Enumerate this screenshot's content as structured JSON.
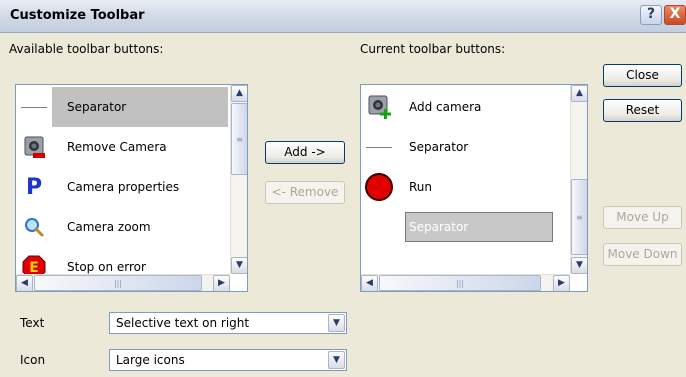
{
  "window": {
    "title": "Customize Toolbar",
    "help_label": "?",
    "close_label": "X"
  },
  "available": {
    "label": "Available toolbar buttons:",
    "items": [
      {
        "label": "Separator",
        "icon": "separator-line",
        "selected": true
      },
      {
        "label": "Remove Camera",
        "icon": "remove-camera-icon"
      },
      {
        "label": "Camera properties",
        "icon": "properties-p-icon"
      },
      {
        "label": "Camera zoom",
        "icon": "zoom-magnifier-icon"
      },
      {
        "label": "Stop on error",
        "icon": "stop-on-error-icon"
      }
    ]
  },
  "current": {
    "label": "Current toolbar buttons:",
    "items": [
      {
        "label": "Add camera",
        "icon": "add-camera-icon"
      },
      {
        "label": "Separator",
        "icon": "separator-line"
      },
      {
        "label": "Run",
        "icon": "run-red-circle-icon"
      },
      {
        "label": "Separator",
        "icon": "separator-placeholder",
        "dragging": true
      }
    ]
  },
  "buttons": {
    "add": "Add ->",
    "remove": "<- Remove",
    "close": "Close",
    "reset": "Reset",
    "move_up": "Move Up",
    "move_down": "Move Down"
  },
  "options": {
    "text_label": "Text",
    "text_value": "Selective text on right",
    "icon_label": "Icon",
    "icon_value": "Large icons"
  },
  "colors": {
    "selection": "#c1c1c1",
    "title_bg": "#d3dbe9",
    "dialog_bg": "#ece9d8",
    "run_red": "#e00000"
  }
}
